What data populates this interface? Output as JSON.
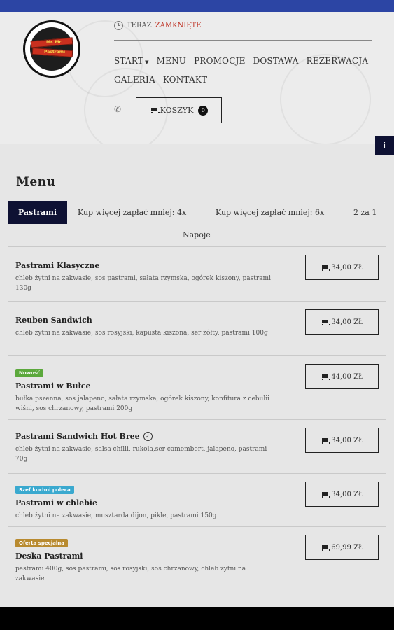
{
  "status": {
    "prefix": "TERAZ",
    "state": "ZAMKNIĘTE"
  },
  "logo": {
    "line1": "Mr. Mr",
    "line2": "Pastrami"
  },
  "nav": {
    "row1": [
      "START",
      "MENU",
      "PROMOCJE",
      "DOSTAWA",
      "REZERWACJA"
    ],
    "row2": [
      "GALERIA",
      "KONTAKT"
    ]
  },
  "cart": {
    "label": "KOSZYK",
    "count": "0"
  },
  "info_icon": "i",
  "menu": {
    "title": "Menu",
    "tabs": [
      "Pastrami",
      "Kup więcej zapłać mniej: 4x",
      "Kup więcej zapłać mniej: 6x",
      "2 za 1",
      "Napoje"
    ],
    "items": [
      {
        "name": "Pastrami Klasyczne",
        "desc": "chleb żytni na zakwasie, sos pastrami, sałata rzymska, ogórek kiszony, pastrami 130g",
        "price": "34,00 ZŁ",
        "badge": ""
      },
      {
        "name": "Reuben Sandwich",
        "desc": "chleb żytni na zakwasie, sos rosyjski, kapusta kiszona, ser żółty, pastrami 100g",
        "price": "34,00 ZŁ",
        "badge": ""
      },
      {
        "name": "Pastrami w Bułce",
        "desc": "bułka pszenna, sos jalapeno, sałata rzymska, ogórek kiszony, konfitura z cebulii wiśni, sos chrzanowy, pastrami 200g",
        "price": "44,00 ZŁ",
        "badge": "Nowość"
      },
      {
        "name": "Pastrami Sandwich Hot Bree",
        "desc": "chleb żytni na zakwasie, salsa chilli, rukola,ser camembert, jalapeno, pastrami 70g",
        "price": "34,00 ZŁ",
        "badge": ""
      },
      {
        "name": "Pastrami w chlebie",
        "desc": "chleb żytni na zakwasie, musztarda dijon, pikle, pastrami 150g",
        "price": "34,00 ZŁ",
        "badge": "Szef kuchni poleca"
      },
      {
        "name": "Deska Pastrami",
        "desc": "pastrami 400g, sos pastrami, sos rosyjski, sos chrzanowy, chleb żytni na zakwasie",
        "price": "69,99 ZŁ",
        "badge": "Oferta specjalna"
      }
    ]
  },
  "colors": {
    "topbar": "#2c45a4",
    "accent": "#0e1133",
    "closed": "#c0392b",
    "badge_new": "#5ba83c",
    "badge_chef": "#3aa9cf",
    "badge_special": "#b88a2f"
  }
}
